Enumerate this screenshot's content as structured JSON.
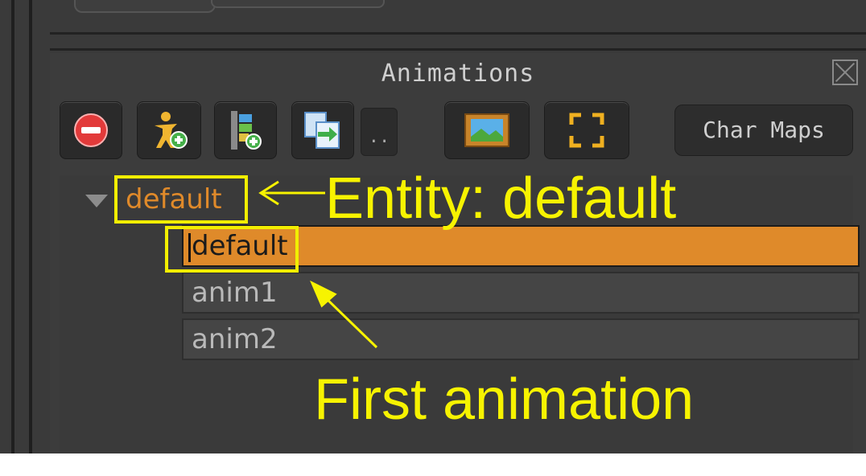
{
  "panel": {
    "title": "Animations"
  },
  "toolbar": {
    "remove_icon": "remove-icon",
    "add_entity_icon": "add-entity-icon",
    "add_animation_icon": "add-animation-icon",
    "duplicate_icon": "duplicate-icon",
    "more_label": "..",
    "preview_icon": "picture-frame-icon",
    "fit_icon": "fullscreen-icon",
    "char_maps_label": "Char Maps"
  },
  "tree": {
    "entity": {
      "name": "default"
    },
    "animations": [
      {
        "name": "default",
        "selected": true
      },
      {
        "name": "anim1",
        "selected": false
      },
      {
        "name": "anim2",
        "selected": false
      }
    ]
  },
  "annotations": {
    "entity_label": "Entity: default",
    "first_animation_label": "First animation"
  },
  "colors": {
    "selection": "#df8a2a",
    "entity_text": "#e08a2a",
    "annotation": "#f7f300",
    "remove_red": "#e23a3a"
  }
}
